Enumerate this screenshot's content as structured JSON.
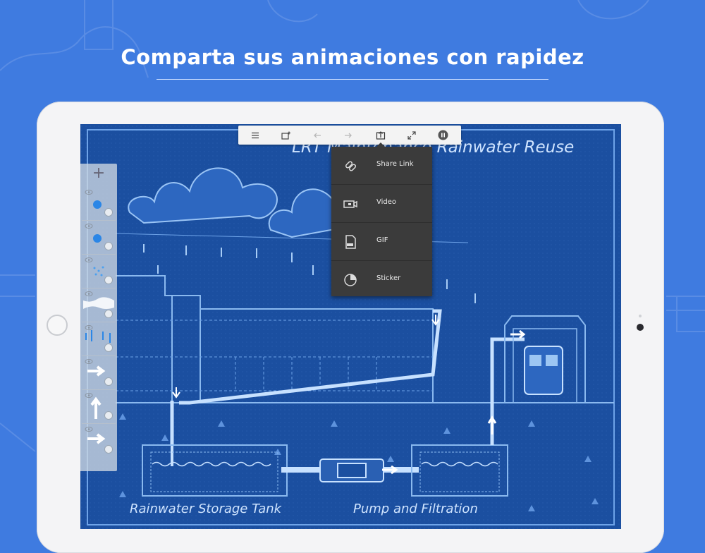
{
  "headline": "Comparta sus animaciones con rapidez",
  "blueprint": {
    "title": "LRT Maintenance Rainwater Reuse",
    "label_tank": "Rainwater Storage Tank",
    "label_pump": "Pump and Filtration"
  },
  "toolbar": {
    "buttons": [
      {
        "icon": "menu-icon"
      },
      {
        "icon": "add-frame-icon"
      },
      {
        "icon": "undo-icon"
      },
      {
        "icon": "redo-icon"
      },
      {
        "icon": "share-icon"
      },
      {
        "icon": "fullscreen-icon"
      },
      {
        "icon": "pause-icon"
      }
    ]
  },
  "share_menu": {
    "items": [
      {
        "label": "Share Link",
        "icon": "link-icon"
      },
      {
        "label": "Video",
        "icon": "video-icon"
      },
      {
        "label": "GIF",
        "icon": "gif-file-icon"
      },
      {
        "label": "Sticker",
        "icon": "sticker-icon"
      }
    ]
  },
  "layers_panel": {
    "add_label": "+",
    "layer_count": 8
  },
  "colors": {
    "background": "#3f7be0",
    "blueprint": "#1b4fa0",
    "menu": "#3b3b3b",
    "toolbar": "#f3f3f3"
  }
}
